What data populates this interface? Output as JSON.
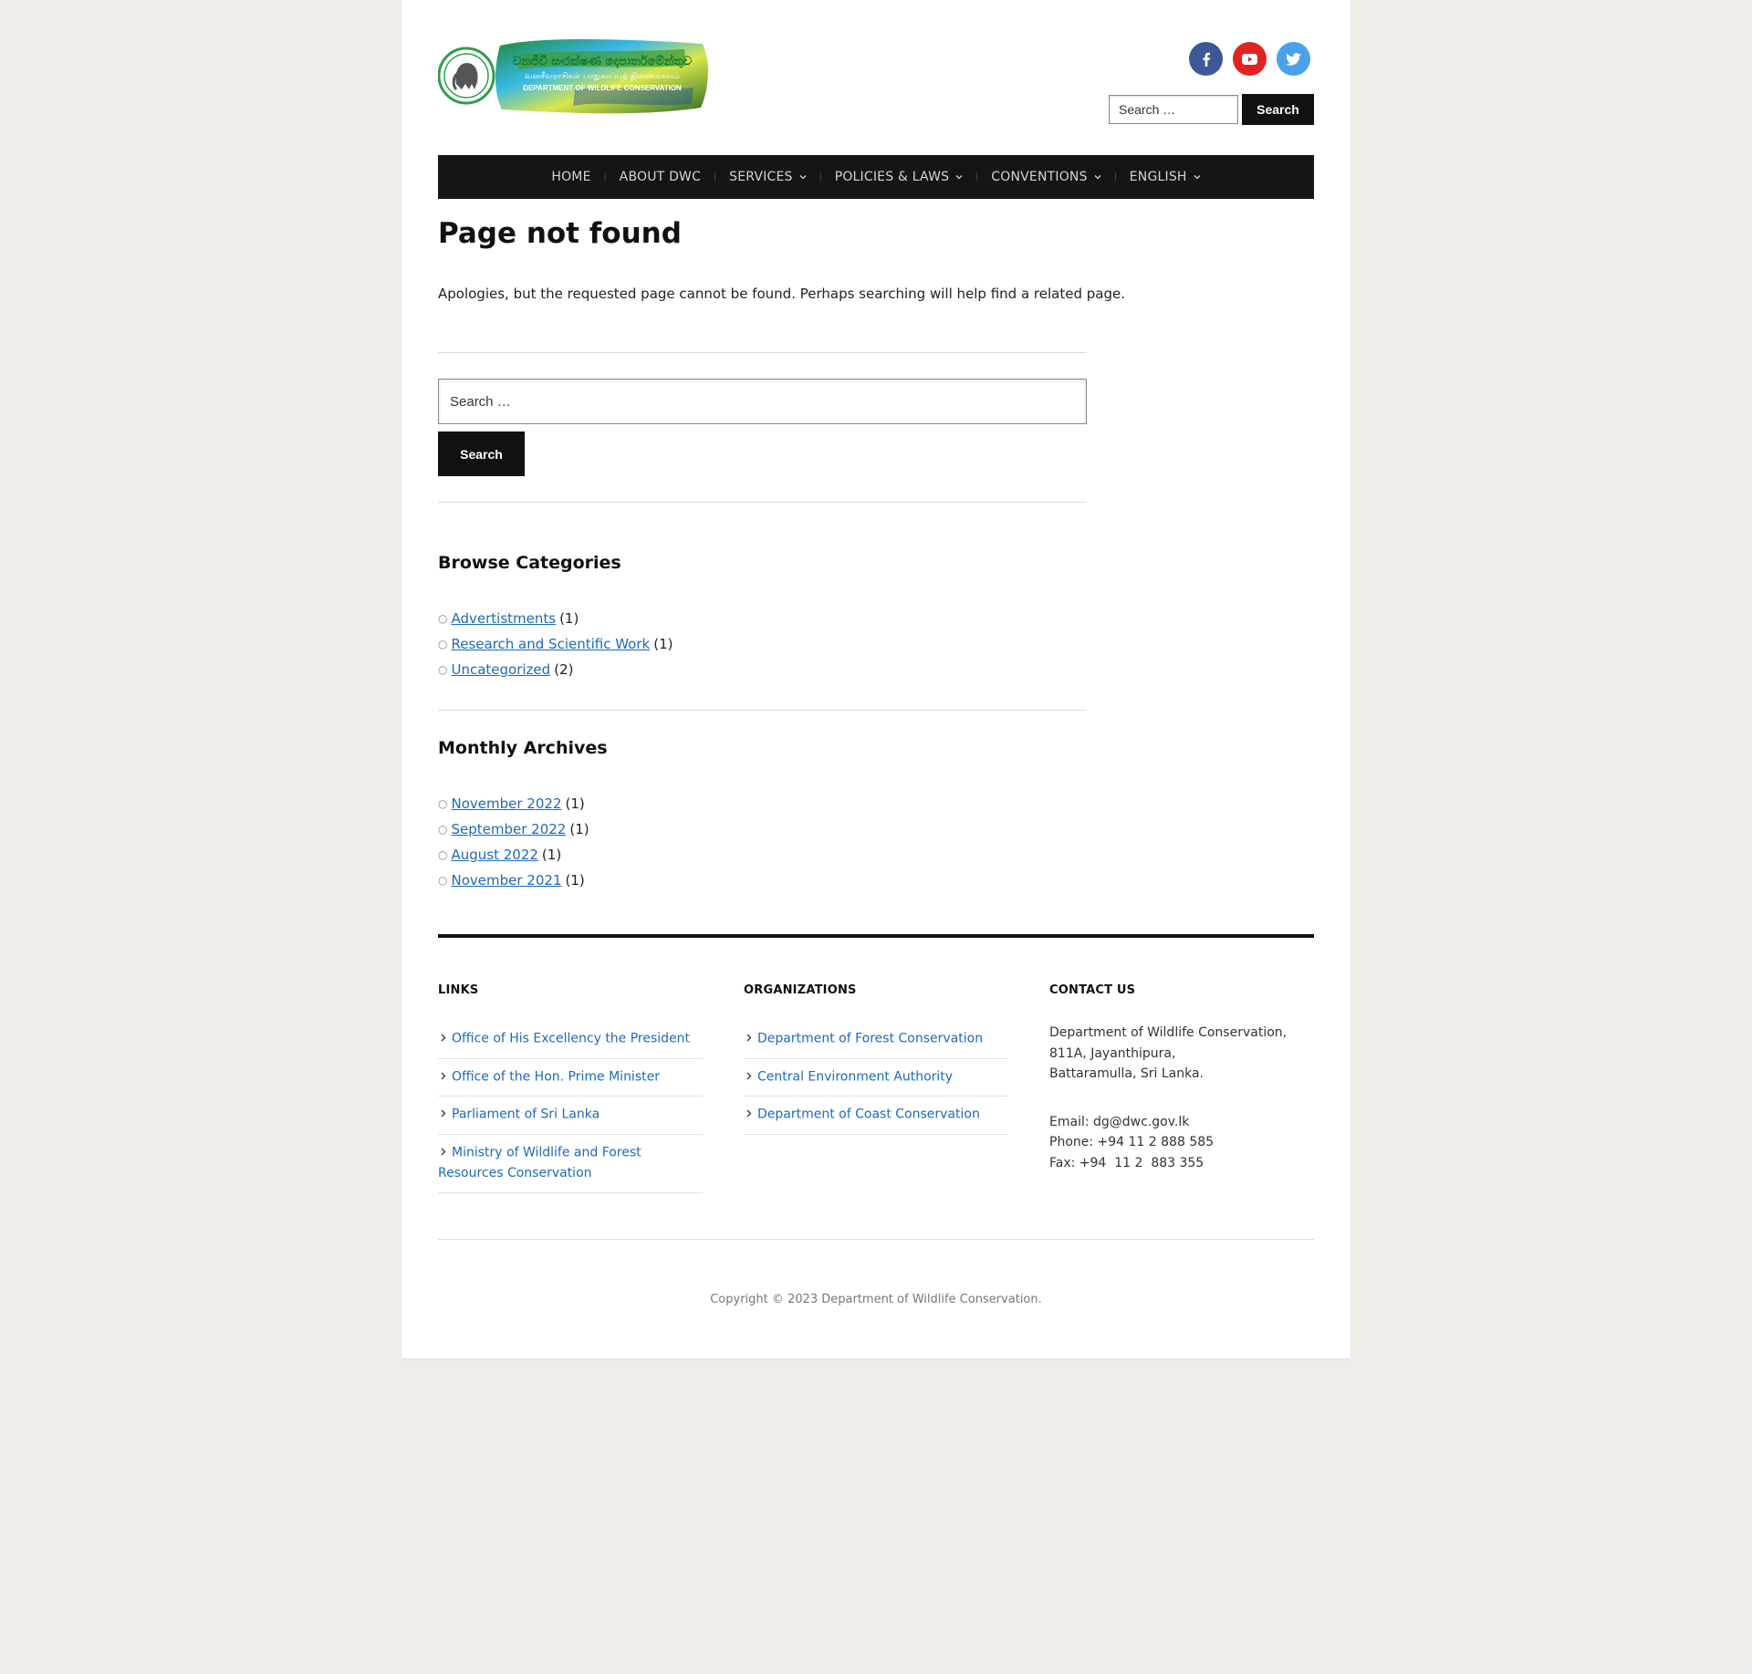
{
  "logo": {
    "line1": "වනජීවී සංරක්ෂණ දෙපාර්තමේන්තුව",
    "line2": "வனசீவராசிகள் பாதுகாப்புத் திணைக்களம்",
    "line3": "DEPARTMENT OF WILDLIFE CONSERVATION"
  },
  "social": {
    "facebook_color": "#3b5998",
    "youtube_color": "#e02424",
    "twitter_color": "#4aa1eb"
  },
  "header_search": {
    "placeholder": "Search …",
    "button": "Search"
  },
  "nav": {
    "items": [
      {
        "label": "HOME"
      },
      {
        "label": "ABOUT DWC"
      },
      {
        "label": "SERVICES"
      },
      {
        "label": "POLICIES & LAWS"
      },
      {
        "label": "CONVENTIONS"
      },
      {
        "label": "ENGLISH"
      }
    ]
  },
  "main": {
    "title": "Page not found",
    "message": "Apologies, but the requested page cannot be found. Perhaps searching will help find a related page.",
    "search": {
      "placeholder": "Search …",
      "button": "Search"
    },
    "categories": {
      "title": "Browse Categories",
      "items": [
        {
          "label": "Advertistments",
          "count": "(1)"
        },
        {
          "label": "Research and Scientific Work",
          "count": "(1)"
        },
        {
          "label": "Uncategorized",
          "count": "(2)"
        }
      ]
    },
    "archives": {
      "title": "Monthly Archives",
      "items": [
        {
          "label": "November 2022",
          "count": "(1)"
        },
        {
          "label": "September 2022",
          "count": "(1)"
        },
        {
          "label": "August 2022",
          "count": "(1)"
        },
        {
          "label": "November 2021",
          "count": "(1)"
        }
      ]
    }
  },
  "footer": {
    "links": {
      "title": "LINKS",
      "items": [
        "Office of His Excellency the President",
        "Office of the Hon. Prime Minister",
        "Parliament of Sri Lanka",
        "Ministry of Wildlife and Forest Resources Conservation"
      ]
    },
    "organizations": {
      "title": "ORGANIZATIONS",
      "items": [
        "Department of Forest Conservation",
        "Central Environment Authority",
        "Department of Coast Conservation"
      ]
    },
    "contact": {
      "title": "CONTACT US",
      "address": [
        "Department of Wildlife Conservation,",
        "811A, Jayanthipura,",
        "Battaramulla, Sri Lanka."
      ],
      "email": "Email: dg@dwc.gov.lk",
      "phone": "Phone: +94 11 2 888 585",
      "fax": "Fax: +94  11 2  883 355"
    },
    "copyright": "Copyright © 2023 Department of Wildlife Conservation."
  }
}
